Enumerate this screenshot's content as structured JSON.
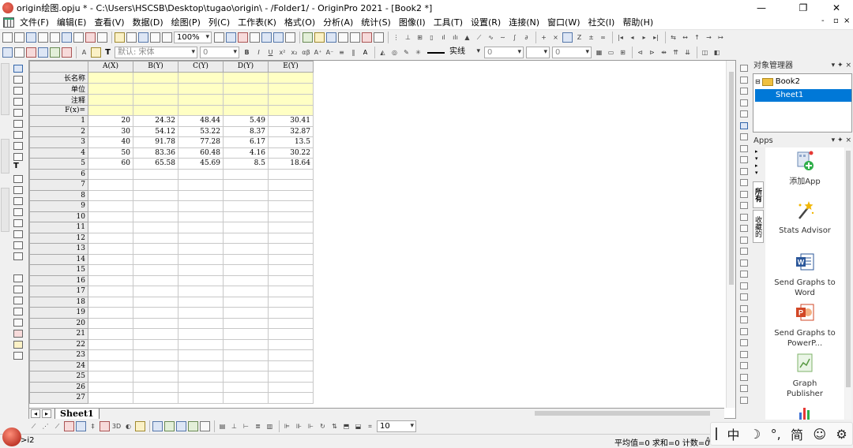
{
  "window": {
    "title": "origin绘图.opju * - C:\\Users\\HSCSB\\Desktop\\tugao\\origin\\ - /Folder1/ - OriginPro 2021 - [Book2 *]",
    "controls": {
      "minimize": "—",
      "restore": "❐",
      "close": "✕"
    }
  },
  "menu": {
    "items": [
      "文件(F)",
      "编辑(E)",
      "查看(V)",
      "数据(D)",
      "绘图(P)",
      "列(C)",
      "工作表(K)",
      "格式(O)",
      "分析(A)",
      "统计(S)",
      "图像(I)",
      "工具(T)",
      "设置(R)",
      "连接(N)",
      "窗口(W)",
      "社交(I)",
      "帮助(H)"
    ],
    "mdi_controls": {
      "minimize": "-",
      "restore": "▫",
      "close": "×"
    }
  },
  "toolbar_standard": {
    "zoom_value": "100%"
  },
  "toolbar_format": {
    "font_default": "默认: 宋体",
    "font_size": "0",
    "line_style": "实线",
    "line_width": "0",
    "other_value": "0"
  },
  "worksheet": {
    "columns": [
      "A(X)",
      "B(Y)",
      "C(Y)",
      "D(Y)",
      "E(Y)"
    ],
    "label_rows": [
      "长名称",
      "单位",
      "注释",
      "F(x)="
    ],
    "rows": [
      [
        "1",
        "20",
        "24.32",
        "48.44",
        "5.49",
        "30.41"
      ],
      [
        "2",
        "30",
        "54.12",
        "53.22",
        "8.37",
        "32.87"
      ],
      [
        "3",
        "40",
        "91.78",
        "77.28",
        "6.17",
        "13.5"
      ],
      [
        "4",
        "50",
        "83.36",
        "60.48",
        "4.16",
        "30.22"
      ],
      [
        "5",
        "60",
        "65.58",
        "45.69",
        "8.5",
        "18.64"
      ],
      [
        "6",
        "",
        "",
        "",
        "",
        ""
      ],
      [
        "7",
        "",
        "",
        "",
        "",
        ""
      ],
      [
        "8",
        "",
        "",
        "",
        "",
        ""
      ],
      [
        "9",
        "",
        "",
        "",
        "",
        ""
      ],
      [
        "10",
        "",
        "",
        "",
        "",
        ""
      ],
      [
        "11",
        "",
        "",
        "",
        "",
        ""
      ],
      [
        "12",
        "",
        "",
        "",
        "",
        ""
      ],
      [
        "13",
        "",
        "",
        "",
        "",
        ""
      ],
      [
        "14",
        "",
        "",
        "",
        "",
        ""
      ],
      [
        "15",
        "",
        "",
        "",
        "",
        ""
      ],
      [
        "16",
        "",
        "",
        "",
        "",
        ""
      ],
      [
        "17",
        "",
        "",
        "",
        "",
        ""
      ],
      [
        "18",
        "",
        "",
        "",
        "",
        ""
      ],
      [
        "19",
        "",
        "",
        "",
        "",
        ""
      ],
      [
        "20",
        "",
        "",
        "",
        "",
        ""
      ],
      [
        "21",
        "",
        "",
        "",
        "",
        ""
      ],
      [
        "22",
        "",
        "",
        "",
        "",
        ""
      ],
      [
        "23",
        "",
        "",
        "",
        "",
        ""
      ],
      [
        "24",
        "",
        "",
        "",
        "",
        ""
      ],
      [
        "25",
        "",
        "",
        "",
        "",
        ""
      ],
      [
        "26",
        "",
        "",
        "",
        "",
        ""
      ],
      [
        "27",
        "",
        "",
        "",
        "",
        ""
      ]
    ],
    "sheet_tab": "Sheet1"
  },
  "object_manager": {
    "title": "对象管理器",
    "book": "Book2",
    "sheet": "Sheet1"
  },
  "apps_panel": {
    "title": "Apps",
    "tabs": [
      "所有",
      "收藏的"
    ],
    "items": [
      {
        "label": "添加App",
        "icon": "add-app-icon"
      },
      {
        "label": "Stats Advisor",
        "icon": "magic-wand-icon"
      },
      {
        "label": "Send Graphs to Word",
        "icon": "word-icon"
      },
      {
        "label": "Send Graphs to PowerP...",
        "icon": "powerpoint-icon"
      },
      {
        "label": "Graph Publisher",
        "icon": "graph-publisher-icon"
      }
    ]
  },
  "bottom_toolbar": {
    "size_value": "10"
  },
  "status_bar": {
    "prompt": ">i2",
    "stats": "平均值=0 求和=0 计数=0",
    "extra": "A"
  },
  "ime_bar": {
    "items": [
      "中",
      "☽",
      "°,",
      "简",
      "☺",
      "⚙"
    ]
  },
  "colors": {
    "label_row_bg": "#ffffc4",
    "selection": "#0078d7",
    "header_bg": "#ececec"
  }
}
